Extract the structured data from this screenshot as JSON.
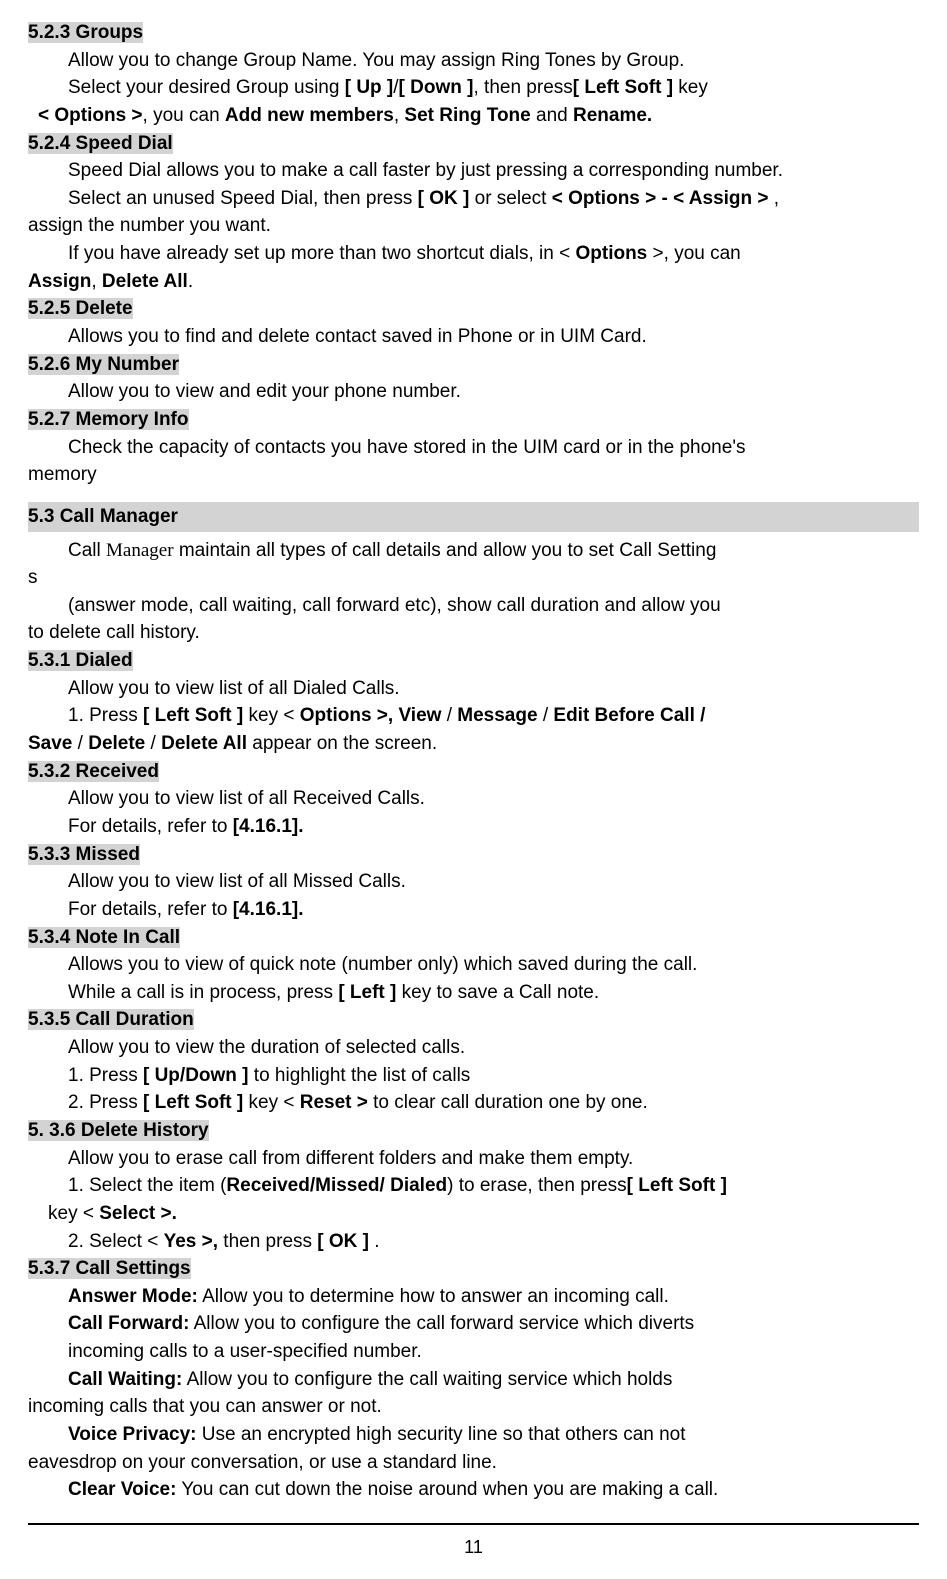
{
  "s523_heading": "5.2.3    Groups",
  "s523_line1a": "Allow you to change Group Name. You may assign Ring Tones by Group.",
  "s523_line2_pre": "Select your desired Group using ",
  "s523_b_up": "[ Up ]",
  "s523_slash": "/",
  "s523_b_down": "[ Down ]",
  "s523_line2_mid": ", then press",
  "s523_b_left": "[ Left Soft ]",
  "s523_line2_end": " key",
  "s523_line3_pre": "< ",
  "s523_b_options": "Options >",
  "s523_line3_mid": ", you can ",
  "s523_b_addnew": "Add new members",
  "s523_line3_mid2": ", ",
  "s523_b_setring": "Set Ring Tone",
  "s523_line3_mid3": " and ",
  "s523_b_rename": "Rename.",
  "s524_heading": "5.2.4    Speed Dial",
  "s524_line1": "Speed Dial allows you to make a call faster by just pressing a corresponding number.",
  "s524_line2_pre": "Select an unused Speed Dial, then press ",
  "s524_b_ok": "[ OK ]",
  "s524_line2_mid": " or select ",
  "s524_b_opt_assign": "< Options > - < Assign >",
  "s524_line2_end": " ,",
  "s524_line3": "assign the number you want.",
  "s524_line4_pre": "If you have already set up more than two shortcut dials, in < ",
  "s524_b_options2": "Options",
  "s524_line4_end": " >, you can",
  "s524_b_assign": "Assign",
  "s524_comma": ", ",
  "s524_b_delall": "Delete All",
  "s524_period": ".",
  "s525_heading": "5.2.5    Delete",
  "s525_line1": "Allows you to find and delete contact saved in Phone or in UIM Card.",
  "s526_heading": "5.2.6    My Number",
  "s526_line1": "Allow  you  to  view  and  edit  your  phone  number.",
  "s527_heading": "5.2.7    Memory Info",
  "s527_line1": "Check the capacity of contacts you have stored in the UIM card or in the phone's",
  "s527_line2": "memory",
  "s53_heading": "5.3 Call Manager",
  "s53_line1_pre": "Call  ",
  "s53_manager": "Manager",
  "s53_line1_post": "  maintain  all  types  of  call  details  and  allow  you  to  set  Call  Setting",
  "s53_line2": "s",
  "s53_line3": "(answer  mode,  call  waiting,  call  forward  etc),  show  call  duration  and  allow  you",
  "s53_line4": "  to  delete  call  history.",
  "s531_heading": "5.3.1    Dialed",
  "s531_line1": "Allow  you  to  view  list  of  all  Dialed  Calls.",
  "s531_line2_pre": "1.  Press  ",
  "s531_b_left": "[  Left  Soft  ]",
  "s531_line2_mid": "  key  <  ",
  "s531_b_opt": "Options  >,",
  "s531_b_view": "   View",
  "s531_s1": "  /  ",
  "s531_b_msg": "Message",
  "s531_s2": "  /  ",
  "s531_b_edit": "Edit  Before  Call  /",
  "s531_b_save": "Save",
  "s531_s3": "  /  ",
  "s531_b_del": "Delete",
  "s531_s4": "  /  ",
  "s531_b_delall": "Delete  All",
  "s531_line3_end": "  appear  on  the  screen.",
  "s532_heading": "5.3.2    Received",
  "s532_line1": "Allow  you  to  view  list  of  all  Received  Calls.",
  "s532_line2_pre": "For  details,  refer  to  ",
  "s532_b_ref": "[4.16.1].",
  "s533_heading": "5.3.3    Missed",
  "s533_line1": "Allow  you  to  view  list  of  all  Missed  Calls.",
  "s533_line2_pre": "For  details,  refer  to  ",
  "s533_b_ref": "[4.16.1].",
  "s534_heading": "5.3.4    Note In Call",
  "s534_line1": "Allows  you  to  view  of  quick  note  (number  only)  which  saved  during  the  call.",
  "s534_line2_pre": "While  a  call  is  in  process,  press  ",
  "s534_b_left": "[  Left  ]",
  "s534_line2_post": "  key  to  save  a  Call  note.",
  "s535_heading": "5.3.5    Call Duration",
  "s535_line1": "Allow  you  to  view  the  duration  of  selected  calls.",
  "s535_line2_pre": "1.  Press  ",
  "s535_b_updown": "[  Up/Down  ]",
  "s535_line2_post": "  to  highlight  the  list  of  calls",
  "s535_line3_pre": "2.  Press  ",
  "s535_b_left": "[  Left  Soft  ]",
  "s535_line3_mid": "  key  <  ",
  "s535_b_reset": "Reset  >",
  "s535_line3_post": "  to  clear  call  duration  one  by  one.",
  "s536_heading": "5. 3.6    Delete History",
  "s536_line1": "Allow  you  to  erase  call  from  different  folders  and  make  them  empty.",
  "s536_line2_pre": "1.  Select  the  item  (",
  "s536_b_rmd": "Received/Missed/  Dialed",
  "s536_line2_mid": ")  to  erase,  then  press",
  "s536_b_left": "[  Left  Soft  ]",
  "s536_line3_pre": "key  <  ",
  "s536_b_select": "Select  >.",
  "s536_line4_pre": "2.  Select  <  ",
  "s536_b_yes": "Yes  >,",
  "s536_line4_mid": "  then  press  ",
  "s536_b_ok": "[  OK  ]",
  "s536_line4_end": "    .",
  "s537_heading": "5.3.7    Call Settings",
  "s537_b_ans": "Answer  Mode:",
  "s537_ans_txt": "  Allow  you  to  determine  how  to  answer  an  incoming  call.",
  "s537_b_cf": "Call  Forward:",
  "s537_cf_txt": "  Allow  you  to  configure  the  call  forward  service  which  diverts",
  "s537_cf_txt2": "incoming  calls  to  a  user-specified  number.",
  "s537_b_cw": "Call  Waiting:",
  "s537_cw_txt": "  Allow  you  to  configure  the  call  waiting  service  which  holds",
  "s537_cw_txt2": "incoming  calls  that  you  can  answer  or  not.",
  "s537_b_vp": "Voice  Privacy:",
  "s537_vp_txt": "  Use  an  encrypted  high  security  line  so  that  others  can  not",
  "s537_vp_txt2": "eavesdrop  on  your  conversation,  or  use  a  standard  line.",
  "s537_b_cv": "Clear  Voice:",
  "s537_cv_txt": "  You  can  cut  down  the  noise  around  when  you  are  making  a  call.",
  "page": "11"
}
